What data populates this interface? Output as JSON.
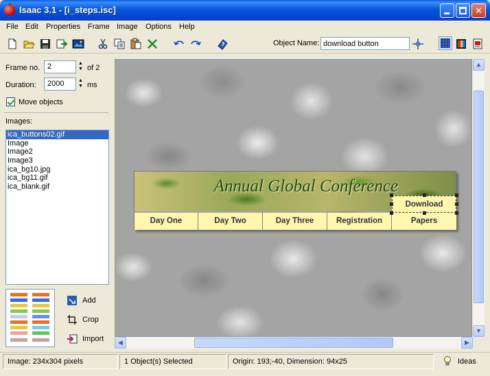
{
  "window": {
    "title": "Isaac 3.1 - [i_steps.isc]",
    "controls": {
      "close_glyph": "✕"
    }
  },
  "menu": [
    "File",
    "Edit",
    "Properties",
    "Frame",
    "Image",
    "Options",
    "Help"
  ],
  "toolbar": {
    "icons": [
      "new-file-icon",
      "open-folder-icon",
      "save-icon",
      "export-icon",
      "image-icon",
      "cut-icon",
      "copy-icon",
      "paste-icon",
      "delete-icon",
      "undo-icon",
      "redo-icon",
      "help-book-icon"
    ],
    "object_name_label": "Object Name:",
    "object_name_value": "download button",
    "right_icons": [
      "pointer-target-icon",
      "grid-view-icon",
      "color-view-icon",
      "print-view-icon"
    ]
  },
  "left_panel": {
    "frame_label": "Frame no.",
    "frame_value": "2",
    "frame_of": "of 2",
    "duration_label": "Duration:",
    "duration_value": "2000",
    "duration_unit": "ms",
    "move_objects_label": "Move objects",
    "move_objects_checked": true,
    "images_label": "Images:",
    "images": [
      "ica_buttons02.gif",
      "Image",
      "Image2",
      "Image3",
      "ica_bg10.jpg",
      "ica_bg11.gif",
      "ica_blank.gif"
    ],
    "selected_image": "ica_buttons02.gif",
    "buttons": {
      "add": "Add",
      "crop": "Crop",
      "import": "Import"
    }
  },
  "canvas": {
    "banner_title": "Annual Global Conference",
    "nav_tabs": [
      "Day One",
      "Day Two",
      "Day Three",
      "Registration",
      "Papers"
    ],
    "download_label": "Download"
  },
  "status": {
    "image": "Image: 234x304 pixels",
    "selection": "1 Object(s) Selected",
    "origin": "Origin: 193;-40, Dimension: 94x25",
    "ideas": "Ideas"
  },
  "colors": {
    "titlebar": "#0347d2",
    "selection": "#316ac5",
    "nav_tab_bg": "#fff7b0",
    "banner_title_color": "#1f4a10"
  }
}
